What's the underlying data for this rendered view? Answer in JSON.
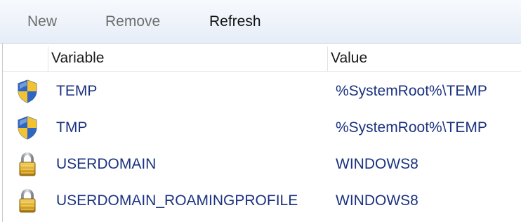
{
  "toolbar": {
    "new_label": "New",
    "remove_label": "Remove",
    "refresh_label": "Refresh"
  },
  "columns": {
    "variable": "Variable",
    "value": "Value"
  },
  "rows": [
    {
      "variable": "TEMP",
      "value": "%SystemRoot%\\TEMP",
      "icon": "shield-icon"
    },
    {
      "variable": "TMP",
      "value": "%SystemRoot%\\TEMP",
      "icon": "shield-icon"
    },
    {
      "variable": "USERDOMAIN",
      "value": "WINDOWS8",
      "icon": "lock-icon"
    },
    {
      "variable": "USERDOMAIN_ROAMINGPROFILE",
      "value": "WINDOWS8",
      "icon": "lock-icon"
    }
  ],
  "colors": {
    "text_link_blue": "#1b3280",
    "disabled_text": "#6d6d6d",
    "toolbar_bg": "#eef3fa"
  }
}
